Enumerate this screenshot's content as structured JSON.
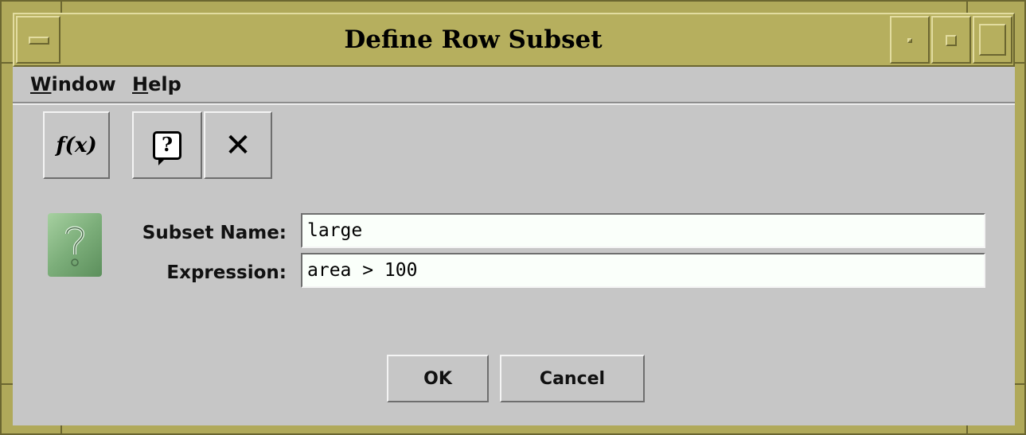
{
  "window": {
    "title": "Define Row Subset",
    "frame_color": "#b6af5e",
    "client_color": "#c6c6c6"
  },
  "menubar": {
    "items": [
      {
        "label": "Window",
        "mnemonic": "W",
        "rest": "indow"
      },
      {
        "label": "Help",
        "mnemonic": "H",
        "rest": "elp"
      }
    ]
  },
  "toolbar": {
    "buttons": [
      {
        "icon": "function-icon",
        "glyph": "f(x)"
      },
      {
        "icon": "help-icon",
        "glyph": "?"
      },
      {
        "icon": "close-icon",
        "glyph": "✕"
      }
    ]
  },
  "form": {
    "subset_name_label": "Subset Name:",
    "subset_name_value": "large",
    "expression_label": "Expression:",
    "expression_value": "area > 100",
    "hint_icon": "question-mark-icon"
  },
  "actions": {
    "ok_label": "OK",
    "cancel_label": "Cancel"
  }
}
